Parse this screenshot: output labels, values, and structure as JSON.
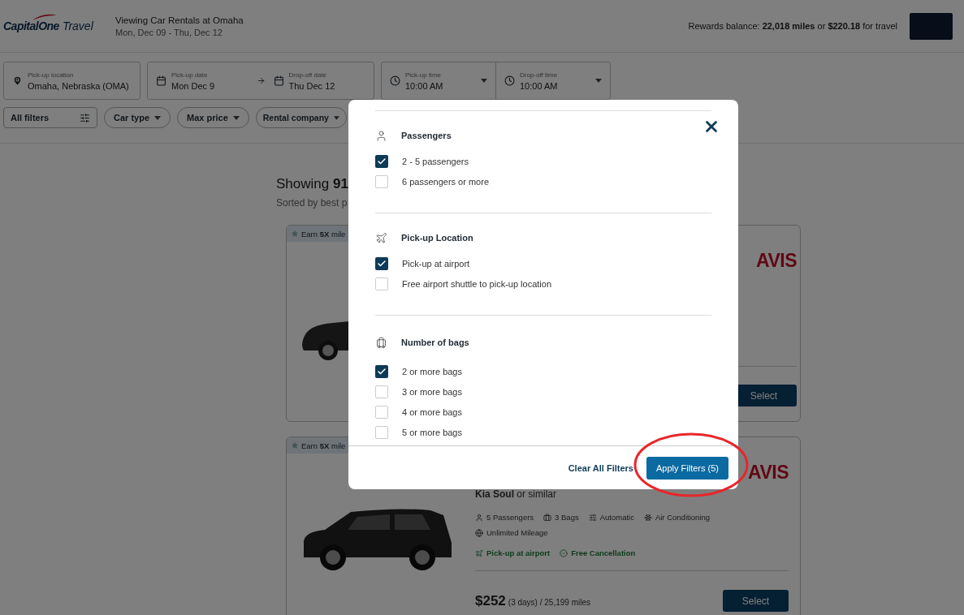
{
  "header": {
    "logo": {
      "brand": "CapitalOne",
      "product": "Travel"
    },
    "title": "Viewing Car Rentals at Omaha",
    "dates": "Mon, Dec 09 - Thu, Dec 12",
    "rewards": "Rewards balance: **22,018 miles** or **$220.18** for travel"
  },
  "search": {
    "location": {
      "label": "Pick-up location",
      "value": "Omaha, Nebraska (OMA)"
    },
    "dates": [
      {
        "label": "Pick-up date",
        "value": "Mon Dec 9"
      },
      {
        "label": "Drop-off date",
        "value": "Thu Dec 12"
      }
    ],
    "times": [
      {
        "label": "Pick-up time",
        "value": "10:00 AM"
      },
      {
        "label": "Drop-off time",
        "value": "10:00 AM"
      }
    ]
  },
  "filters": [
    {
      "kind": "all",
      "label": "All filters"
    },
    {
      "kind": "dropdown",
      "label": "Car type"
    },
    {
      "kind": "dropdown",
      "label": "Max price"
    },
    {
      "kind": "dropdown",
      "label": "Rental company"
    }
  ],
  "results": {
    "count": "Showing **91**",
    "sort": "Sorted by best p",
    "cards": [
      {
        "badge": "Earn **5X** mile",
        "vendor": "AVIS",
        "button": "Select"
      },
      {
        "badge": "Earn **5X** mile",
        "vendor": "AVIS",
        "car": "**Kia Soul** or similar",
        "features": [
          {
            "kind": "passengers",
            "label": "5 Passengers"
          },
          {
            "kind": "bags",
            "label": "3 Bags"
          },
          {
            "kind": "transmission",
            "label": "Automatic"
          },
          {
            "kind": "ac",
            "label": "Air Conditioning"
          },
          {
            "kind": "mileage",
            "label": "Unlimited Mileage"
          }
        ],
        "perks": [
          {
            "kind": "airport",
            "label": "Pick-up at airport"
          },
          {
            "kind": "cancellation",
            "label": "Free Cancellation"
          }
        ],
        "price": "$252",
        "price_detail": "(3 days) / 25,199 miles",
        "button": "Select"
      }
    ]
  },
  "modal": {
    "sections": [
      {
        "kind": "passengers",
        "title": "Passengers",
        "options": [
          {
            "label": "2 - 5 passengers",
            "checked": true
          },
          {
            "label": "6 passengers or more",
            "checked": false
          }
        ]
      },
      {
        "kind": "location",
        "title": "Pick-up Location",
        "options": [
          {
            "label": "Pick-up at airport",
            "checked": true
          },
          {
            "label": "Free airport shuttle to pick-up location",
            "checked": false
          }
        ]
      },
      {
        "kind": "bags",
        "title": "Number of bags",
        "options": [
          {
            "label": "2 or more bags",
            "checked": true
          },
          {
            "label": "3 or more bags",
            "checked": false
          },
          {
            "label": "4 or more bags",
            "checked": false
          },
          {
            "label": "5 or more bags",
            "checked": false
          }
        ]
      }
    ],
    "clear": "Clear All Filters",
    "apply": "Apply Filters (5)"
  }
}
